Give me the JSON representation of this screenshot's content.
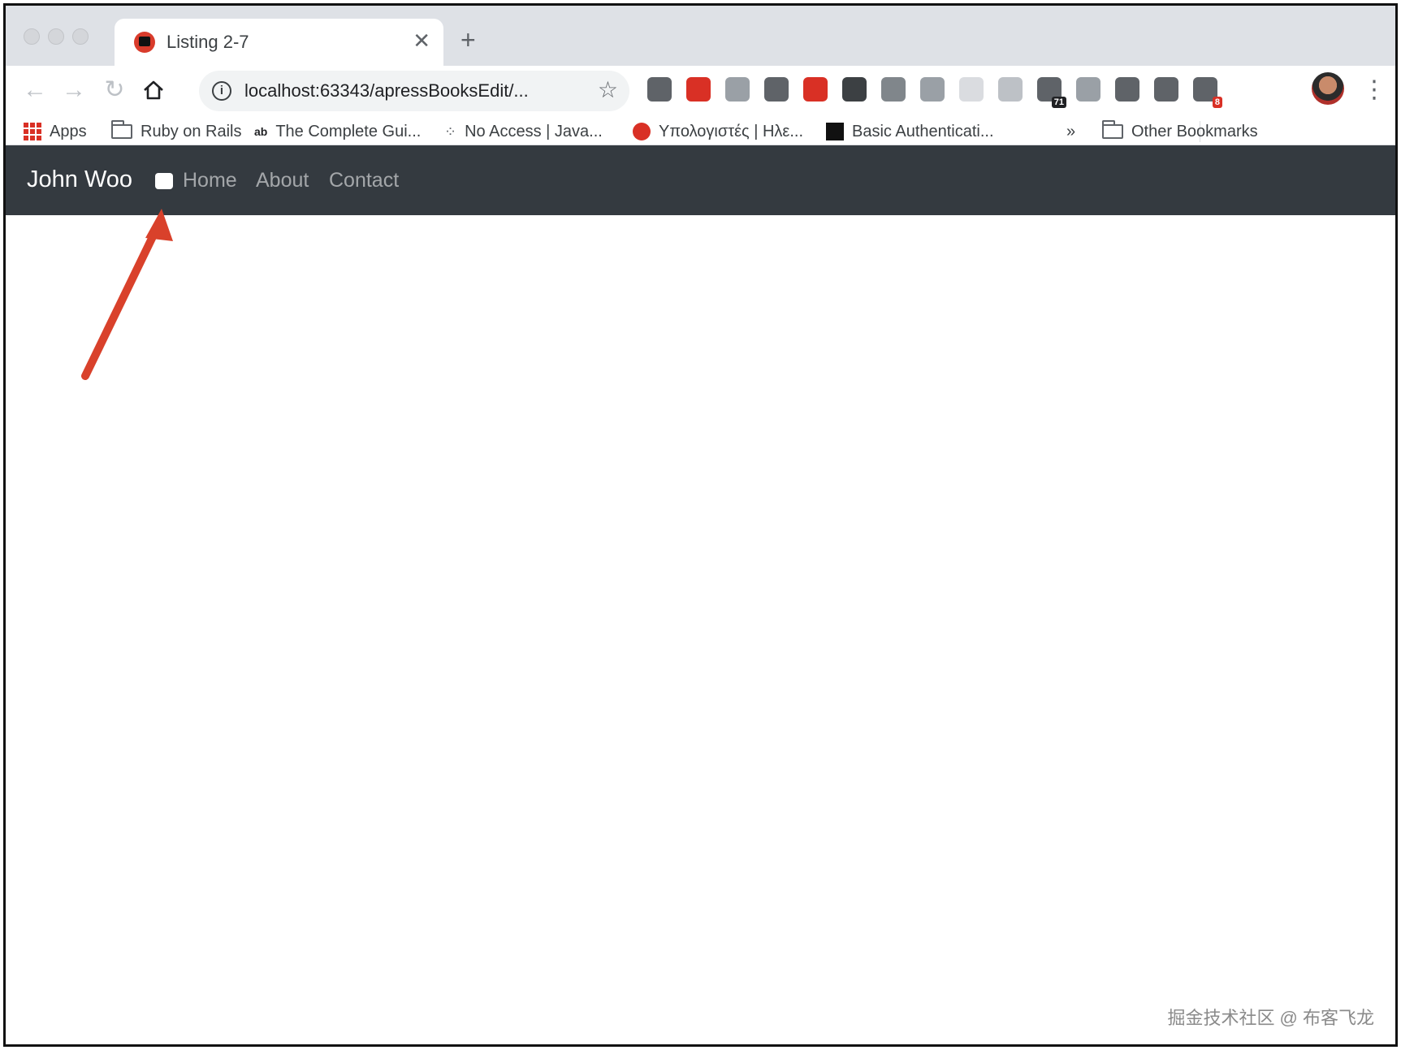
{
  "browser": {
    "tab": {
      "title": "Listing 2-7"
    },
    "address": {
      "url": "localhost:63343/apressBooksEdit/..."
    },
    "extensions": [
      {
        "icon": "eyedropper-icon",
        "color": "#5f6368"
      },
      {
        "icon": "network-icon",
        "color": "#d93025"
      },
      {
        "icon": "opera-icon",
        "color": "#9aa0a6"
      },
      {
        "icon": "c-letter-icon",
        "color": "#5f6368"
      },
      {
        "icon": "target-icon",
        "color": "#d93025"
      },
      {
        "icon": "lightbulb-icon",
        "color": "#3c4043"
      },
      {
        "icon": "download-icon",
        "color": "#80868b"
      },
      {
        "icon": "screenshot-icon",
        "color": "#9aa0a6"
      },
      {
        "icon": "blank-extension-icon",
        "color": "#dadce0"
      },
      {
        "icon": "camera-icon",
        "color": "#bdc1c6"
      },
      {
        "icon": "tag-icon",
        "color": "#5f6368",
        "badge": "71"
      },
      {
        "icon": "globe-icon",
        "color": "#9aa0a6"
      },
      {
        "icon": "a-circle-icon",
        "color": "#5f6368"
      },
      {
        "icon": "move-icon",
        "color": "#5f6368"
      },
      {
        "icon": "a-badge-icon",
        "color": "#5f6368",
        "badge": "8"
      }
    ]
  },
  "bookmarks": {
    "apps": "Apps",
    "items": [
      "Ruby on Rails",
      "The Complete Gui...",
      "No Access | Java...",
      "Υπολογιστές | Ηλε...",
      "Basic Authenticati..."
    ],
    "overflow": "»",
    "other": "Other Bookmarks"
  },
  "navbar": {
    "brand": "John Woo",
    "links": [
      "Home",
      "About",
      "Contact"
    ],
    "background": "#343a40"
  },
  "annotation": {
    "arrow_color": "#d9412b"
  },
  "watermark": "掘金技术社区 @ 布客飞龙"
}
